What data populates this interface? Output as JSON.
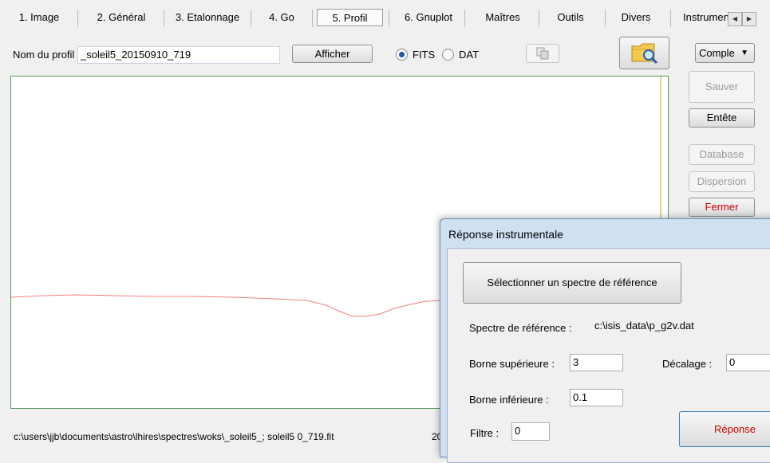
{
  "tabs": [
    {
      "label": "1. Image",
      "selected": false
    },
    {
      "label": "2. Général",
      "selected": false
    },
    {
      "label": "3. Etalonnage",
      "selected": false
    },
    {
      "label": "4. Go",
      "selected": false
    },
    {
      "label": "5. Profil",
      "selected": true
    },
    {
      "label": "6. Gnuplot",
      "selected": false
    },
    {
      "label": "Maîtres",
      "selected": false
    },
    {
      "label": "Outils",
      "selected": false
    },
    {
      "label": "Divers",
      "selected": false
    },
    {
      "label": "Instrumentation",
      "selected": false
    }
  ],
  "toolbar": {
    "profile_name_label": "Nom du profil",
    "profile_name_value": "_soleil5_20150910_719",
    "show_button": "Afficher",
    "format_fits": "FITS",
    "format_dat": "DAT",
    "selected_format": "FITS",
    "dropdown_value": "Comple"
  },
  "side_buttons": {
    "save": "Sauver",
    "header": "Entête",
    "database": "Database",
    "dispersion": "Dispersion",
    "close": "Fermer"
  },
  "status": {
    "path": "c:\\users\\jjb\\documents\\astro\\lhires\\spectres\\woks\\_soleil5_; soleil5  0_719.fit",
    "extra": "20"
  },
  "dialog": {
    "title": "Réponse instrumentale",
    "select_button": "Sélectionner un spectre de référence",
    "reference_label": "Spectre de référence :",
    "reference_value": "c:\\isis_data\\p_g2v.dat",
    "upper_label": "Borne supérieure :",
    "upper_value": "3",
    "offset_label": "Décalage :",
    "offset_value": "0",
    "lower_label": "Borne inférieure :",
    "lower_value": "0.1",
    "filter_label": "Filtre :",
    "filter_value": "0",
    "response_button": "Réponse"
  },
  "colors": {
    "profile_curve": "#f08080",
    "plot_border": "#5a9a5a",
    "marker_line": "#d4a020",
    "close_text": "#cc0000"
  }
}
